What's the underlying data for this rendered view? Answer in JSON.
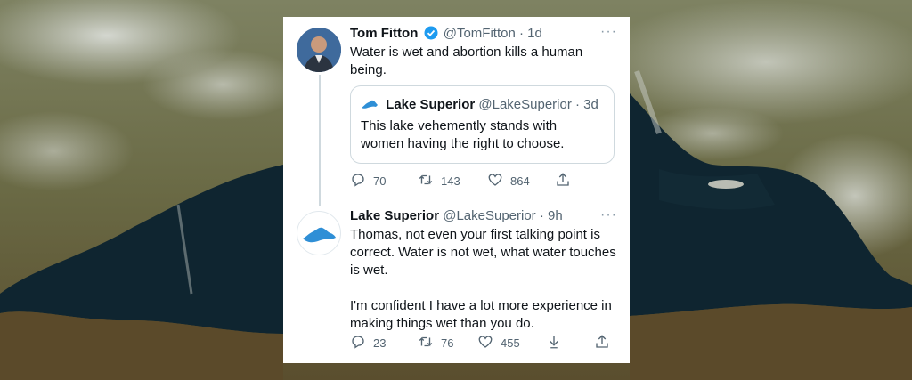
{
  "tweets": [
    {
      "name": "Tom Fitton",
      "handle": "@TomFitton",
      "time": "· 1d",
      "text": "Water is wet and abortion kills a human being.",
      "verified": true,
      "quote": {
        "name": "Lake Superior",
        "handle": "@LakeSuperior",
        "time": "· 3d",
        "text": "This lake vehemently stands with women having the right to choose."
      },
      "replies": "70",
      "retweets": "143",
      "likes": "864"
    },
    {
      "name": "Lake Superior",
      "handle": "@LakeSuperior",
      "time": "· 9h",
      "text": "Thomas, not even your first talking point is correct. Water is not wet, what water touches is wet.\n\nI'm confident I have a lot more experience in making things wet than you do.",
      "replies": "23",
      "retweets": "76",
      "likes": "455"
    }
  ],
  "more_label": "···",
  "colors": {
    "verified": "#1d9bf0",
    "lake_logo": "#2f8fd6",
    "muted": "#536471"
  }
}
